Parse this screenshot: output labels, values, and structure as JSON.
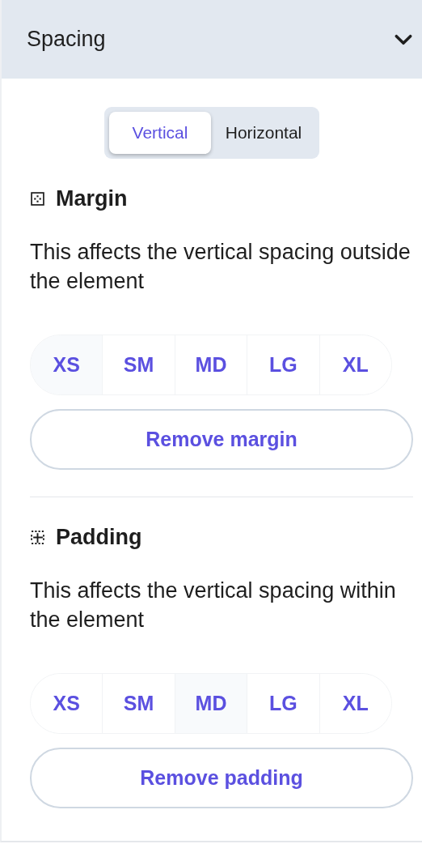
{
  "panel": {
    "title": "Spacing",
    "expanded": true
  },
  "tabs": [
    {
      "label": "Vertical",
      "selected": true
    },
    {
      "label": "Horizontal",
      "selected": false
    }
  ],
  "sections": [
    {
      "kind": "margin",
      "title": "Margin",
      "description": "This affects the vertical spacing outside the element",
      "sizes": [
        {
          "label": "XS",
          "selected": true
        },
        {
          "label": "SM",
          "selected": false
        },
        {
          "label": "MD",
          "selected": false
        },
        {
          "label": "LG",
          "selected": false
        },
        {
          "label": "XL",
          "selected": false
        }
      ],
      "button": "Remove margin"
    },
    {
      "kind": "padding",
      "title": "Padding",
      "description": "This affects the vertical spacing within the element",
      "sizes": [
        {
          "label": "XS",
          "selected": false
        },
        {
          "label": "SM",
          "selected": false
        },
        {
          "label": "MD",
          "selected": true
        },
        {
          "label": "LG",
          "selected": false
        },
        {
          "label": "XL",
          "selected": false
        }
      ],
      "button": "Remove padding"
    }
  ]
}
